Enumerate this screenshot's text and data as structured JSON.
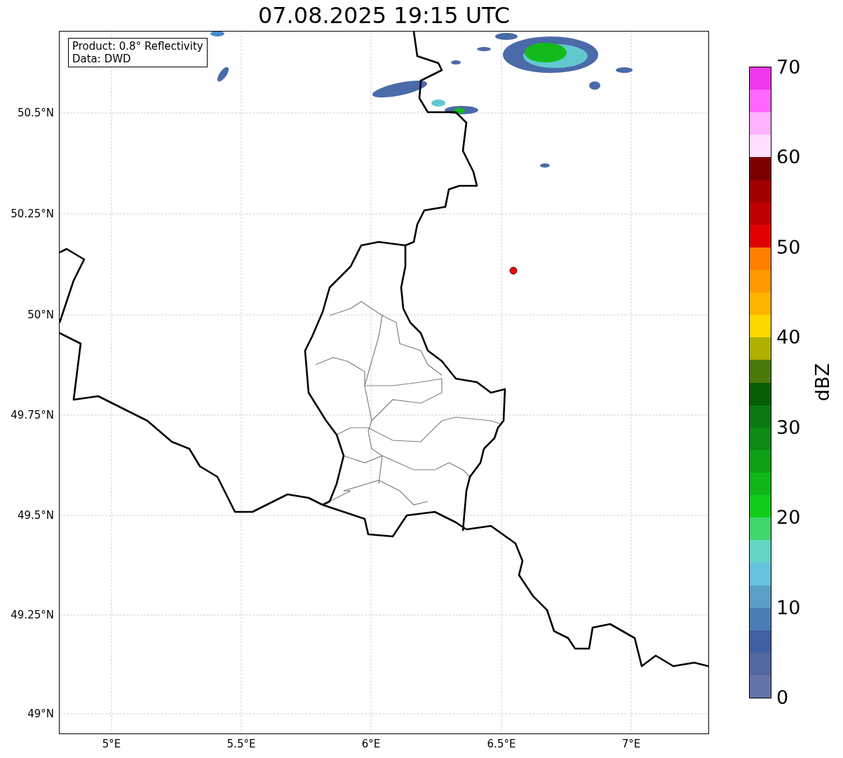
{
  "title": "07.08.2025 19:15 UTC",
  "info_box": [
    "Product: 0.8° Reflectivity",
    "Data: DWD"
  ],
  "map": {
    "y_ticks": [
      "50.5°N",
      "50.25°N",
      "50°N",
      "49.75°N",
      "49.5°N",
      "49.25°N",
      "49°N"
    ],
    "x_ticks": [
      "5°E",
      "5.5°E",
      "6°E",
      "6.5°E",
      "7°E"
    ]
  },
  "colorbar": {
    "label": "dBZ",
    "ticks": [
      "70",
      "60",
      "50",
      "40",
      "30",
      "20",
      "10",
      "0"
    ],
    "segments": [
      {
        "color": "#ee38ee"
      },
      {
        "color": "#ff66ff"
      },
      {
        "color": "#ffb3ff"
      },
      {
        "color": "#ffe0ff"
      },
      {
        "color": "#7a0000"
      },
      {
        "color": "#9f0000"
      },
      {
        "color": "#c00000"
      },
      {
        "color": "#e00000"
      },
      {
        "color": "#ff7f00"
      },
      {
        "color": "#ff9900"
      },
      {
        "color": "#ffb300"
      },
      {
        "color": "#ffd700"
      },
      {
        "color": "#b0b000"
      },
      {
        "color": "#4a7a0a"
      },
      {
        "color": "#075f07"
      },
      {
        "color": "#0a7a10"
      },
      {
        "color": "#0d8c13"
      },
      {
        "color": "#0f9f15"
      },
      {
        "color": "#10b618"
      },
      {
        "color": "#12cc1a"
      },
      {
        "color": "#3ed66d"
      },
      {
        "color": "#62d6c2"
      },
      {
        "color": "#66c2dd"
      },
      {
        "color": "#5a9fc6"
      },
      {
        "color": "#4a7db5"
      },
      {
        "color": "#4260a6"
      },
      {
        "color": "#5268a0"
      },
      {
        "color": "#6474a8"
      }
    ]
  }
}
